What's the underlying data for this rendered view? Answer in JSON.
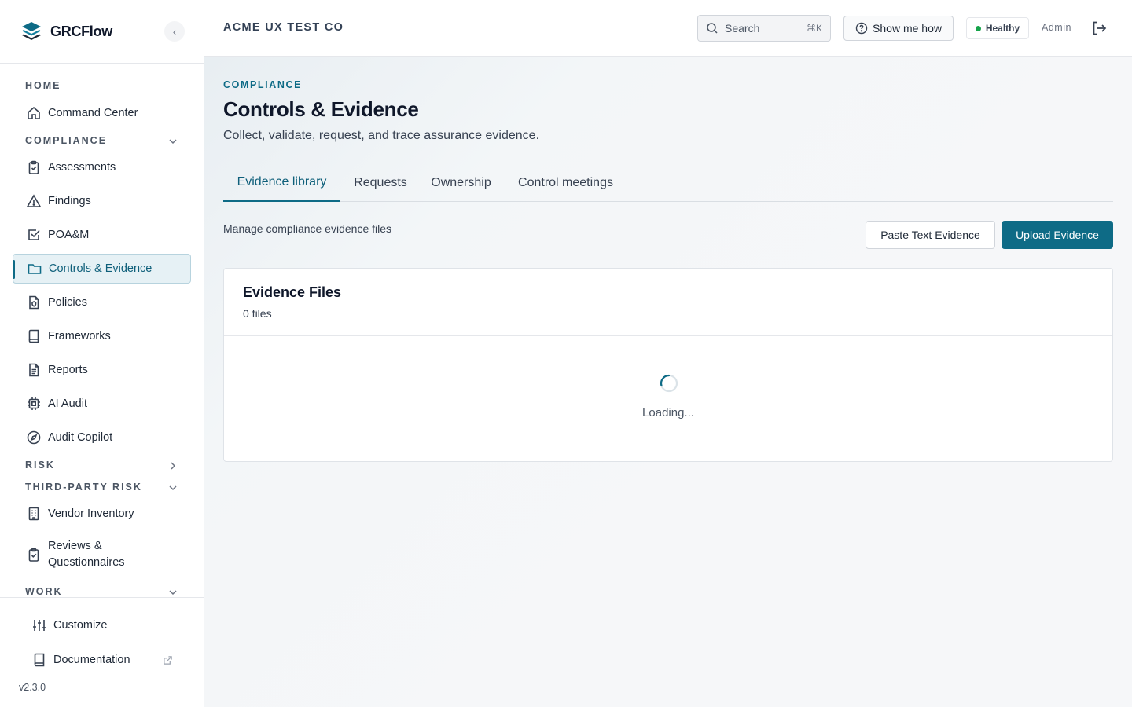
{
  "brand": {
    "name": "GRCFlow"
  },
  "sidebar": {
    "collapse_icon": "chevron-left-icon",
    "sections": {
      "home": "HOME",
      "compliance": "COMPLIANCE",
      "risk": "RISK",
      "third_party_risk": "THIRD-PARTY RISK",
      "work": "WORK"
    },
    "items": {
      "command_center": "Command Center",
      "assessments": "Assessments",
      "findings": "Findings",
      "poam": "POA&M",
      "controls_evidence": "Controls & Evidence",
      "policies": "Policies",
      "frameworks": "Frameworks",
      "reports": "Reports",
      "ai_audit": "AI Audit",
      "audit_copilot": "Audit Copilot",
      "vendor_inventory": "Vendor Inventory",
      "reviews_line1": "Reviews &",
      "reviews_line2": "Questionnaires"
    },
    "active_item": "Controls & Evidence",
    "footer": {
      "customize": "Customize",
      "documentation": "Documentation",
      "version": "v2.3.0"
    }
  },
  "topbar": {
    "org_name": "ACME UX TEST CO",
    "search_placeholder": "Search",
    "search_shortcut": "⌘K",
    "show_me_how": "Show me how",
    "status": "Healthy",
    "status_color": "#16a34a",
    "user_role": "Admin"
  },
  "page": {
    "eyebrow": "COMPLIANCE",
    "title": "Controls & Evidence",
    "subtitle": "Collect, validate, request, and trace assurance evidence.",
    "tabs": [
      "Evidence library",
      "Requests",
      "Ownership",
      "Control meetings"
    ],
    "active_tab": "Evidence library",
    "manage_text": "Manage compliance evidence files",
    "paste_button": "Paste Text Evidence",
    "upload_button": "Upload Evidence",
    "card": {
      "title": "Evidence Files",
      "count": "0 files",
      "loading": "Loading..."
    }
  },
  "colors": {
    "accent": "#0e6b86",
    "active_bg": "#e6f1f5"
  }
}
